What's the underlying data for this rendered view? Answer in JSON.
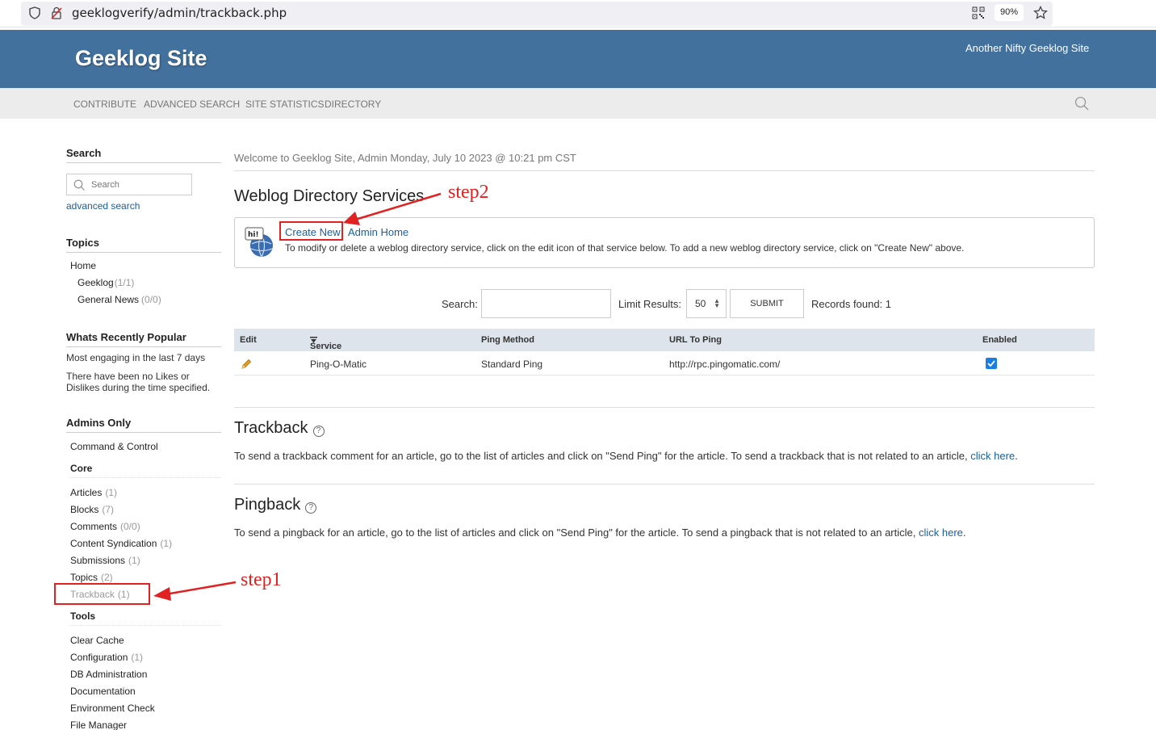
{
  "browser": {
    "url": "geeklogverify/admin/trackback.php",
    "zoom": "90%"
  },
  "header": {
    "site_title": "Geeklog Site",
    "slogan": "Another Nifty Geeklog Site"
  },
  "nav": {
    "items": [
      "CONTRIBUTE",
      "ADVANCED SEARCH",
      "SITE STATISTICS",
      "DIRECTORY"
    ]
  },
  "sidebar": {
    "search": {
      "heading": "Search",
      "placeholder": "Search",
      "advanced_link": "advanced search"
    },
    "topics": {
      "heading": "Topics",
      "home": "Home",
      "items": [
        {
          "label": "Geeklog",
          "count": "(1/1)"
        },
        {
          "label": "General News",
          "count": "(0/0)"
        }
      ]
    },
    "popular": {
      "heading": "Whats Recently Popular",
      "line1": "Most engaging in the last 7 days",
      "line2": "There have been no Likes or Dislikes during the time specified."
    },
    "admins": {
      "heading": "Admins Only",
      "command": "Command & Control",
      "core_heading": "Core",
      "core": [
        {
          "label": "Articles",
          "count": "(1)"
        },
        {
          "label": "Blocks",
          "count": "(7)"
        },
        {
          "label": "Comments",
          "count": "(0/0)"
        },
        {
          "label": "Content Syndication",
          "count": "(1)"
        },
        {
          "label": "Submissions",
          "count": "(1)"
        },
        {
          "label": "Topics",
          "count": "(2)"
        },
        {
          "label": "Trackback",
          "count": "(1)"
        }
      ],
      "tools_heading": "Tools",
      "tools": [
        {
          "label": "Clear Cache",
          "count": ""
        },
        {
          "label": "Configuration",
          "count": "(1)"
        },
        {
          "label": "DB Administration",
          "count": ""
        },
        {
          "label": "Documentation",
          "count": ""
        },
        {
          "label": "Environment Check",
          "count": ""
        },
        {
          "label": "File Manager",
          "count": ""
        }
      ]
    }
  },
  "main": {
    "welcome": "Welcome to Geeklog Site, Admin Monday, July 10 2023 @ 10:21 pm CST",
    "directory_title": "Weblog Directory Services",
    "create_new": "Create New",
    "admin_home": "Admin Home",
    "description": "To modify or delete a weblog directory service, click on the edit icon of that service below. To add a new weblog directory service, click on \"Create New\" above.",
    "filter": {
      "search_label": "Search:",
      "limit_label": "Limit Results:",
      "limit_value": "50",
      "submit": "SUBMIT",
      "records": "Records found: 1"
    },
    "table": {
      "columns": [
        "Edit",
        "Service",
        "Ping Method",
        "URL To Ping",
        "Enabled"
      ],
      "rows": [
        {
          "service": "Ping-O-Matic",
          "method": "Standard Ping",
          "url": "http://rpc.pingomatic.com/",
          "enabled": true
        }
      ]
    },
    "trackback": {
      "title": "Trackback",
      "text": "To send a trackback comment for an article, go to the list of articles and click on \"Send Ping\" for the article. To send a trackback that is not related to an article,",
      "link": "click here"
    },
    "pingback": {
      "title": "Pingback",
      "text": "To send a pingback for an article, go to the list of articles and click on \"Send Ping\" for the article. To send a pingback that is not related to an article,",
      "link": "click here"
    }
  },
  "annotations": {
    "step1": "step1",
    "step2": "step2",
    "color": "#e02222"
  }
}
